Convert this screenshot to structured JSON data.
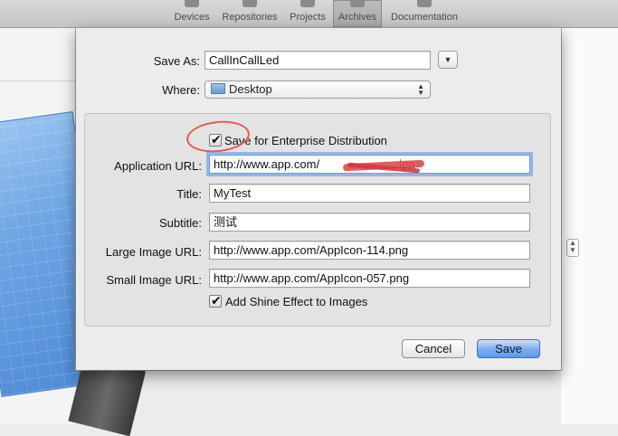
{
  "toolbar": {
    "items": [
      {
        "label": "Devices"
      },
      {
        "label": "Repositories"
      },
      {
        "label": "Projects"
      },
      {
        "label": "Archives"
      },
      {
        "label": "Documentation"
      }
    ],
    "active": "Archives"
  },
  "sheet": {
    "save_as": {
      "label": "Save As:",
      "value": "CallInCallLed"
    },
    "where": {
      "label": "Where:",
      "value": "Desktop"
    },
    "enterprise": {
      "label": "Save for Enterprise Distribution",
      "checked": true
    },
    "fields": {
      "application_url": {
        "label": "Application URL:",
        "value": "http://www.app.com/",
        "value_suffix": "ipa"
      },
      "title": {
        "label": "Title:",
        "value": "MyTest"
      },
      "subtitle": {
        "label": "Subtitle:",
        "value": "测试"
      },
      "large_image_url": {
        "label": "Large Image URL:",
        "value": "http://www.app.com/AppIcon-114.png"
      },
      "small_image_url": {
        "label": "Small Image URL:",
        "value": "http://www.app.com/AppIcon-057.png"
      }
    },
    "shine": {
      "label": "Add Shine Effect to Images",
      "checked": true
    },
    "buttons": {
      "cancel": "Cancel",
      "save": "Save"
    }
  },
  "colors": {
    "accent": "#5d98e6",
    "annotation": "#e25a4f"
  }
}
